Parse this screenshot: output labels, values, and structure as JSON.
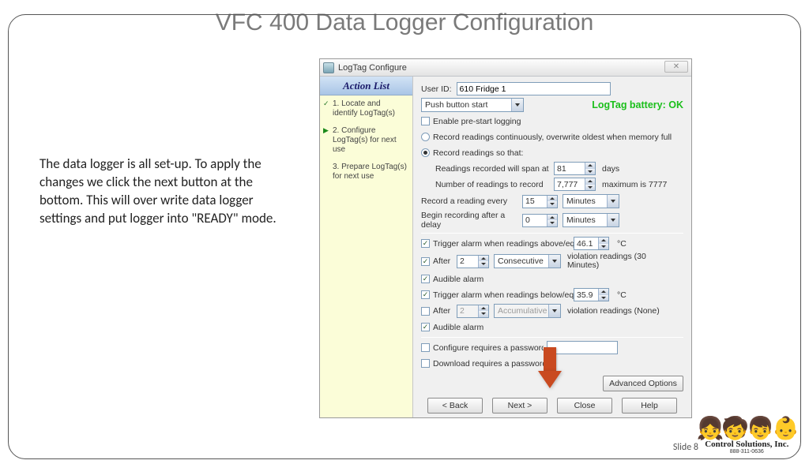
{
  "slide": {
    "title": "VFC 400 Data Logger Configuration",
    "body": "The data logger is all set-up. To apply the changes we click the next button at the bottom. This will over write data logger settings and put logger into \"READY\" mode.",
    "number": "Slide 8"
  },
  "footer": {
    "company": "Control Solutions, Inc.",
    "phone": "888-311-0636"
  },
  "dialog": {
    "title": "LogTag Configure",
    "sidebar_header": "Action List",
    "steps": {
      "s1": "1. Locate and identify LogTag(s)",
      "s2": "2. Configure LogTag(s) for next use",
      "s3": "3. Prepare LogTag(s) for next use"
    },
    "userid_label": "User ID:",
    "userid_value": "610 Fridge 1",
    "start_mode": "Push button start",
    "battery": "LogTag battery: OK",
    "enable_prestart": "Enable pre-start logging",
    "record_continuous": "Record readings continuously, overwrite oldest when memory full",
    "record_so_that": "Record readings so that:",
    "span_label": "Readings recorded will span at",
    "span_value": "81",
    "span_unit": "days",
    "numreadings_label": "Number of readings to record",
    "numreadings_value": "7,777",
    "numreadings_max": "maximum is 7777",
    "record_every_label": "Record a reading every",
    "record_every_value": "15",
    "record_every_unit": "Minutes",
    "delay_label": "Begin recording after a delay",
    "delay_value": "0",
    "delay_unit": "Minutes",
    "trigger_above": "Trigger alarm when readings above/equa",
    "trigger_above_val": "46.1",
    "deg": "°C",
    "after_label": "After",
    "after_above_val": "2",
    "after_above_mode": "Consecutive",
    "after_above_note": "violation readings (30 Minutes)",
    "audible": "Audible alarm",
    "trigger_below": "Trigger alarm when readings below/equa",
    "trigger_below_val": "35.9",
    "after_below_val": "2",
    "after_below_mode": "Accumulative",
    "after_below_note": "violation readings (None)",
    "configure_pw": "Configure requires a password",
    "download_pw": "Download requires a password",
    "advanced": "Advanced Options",
    "btn_back": "<  Back",
    "btn_next": "Next  >",
    "btn_close": "Close",
    "btn_help": "Help"
  }
}
